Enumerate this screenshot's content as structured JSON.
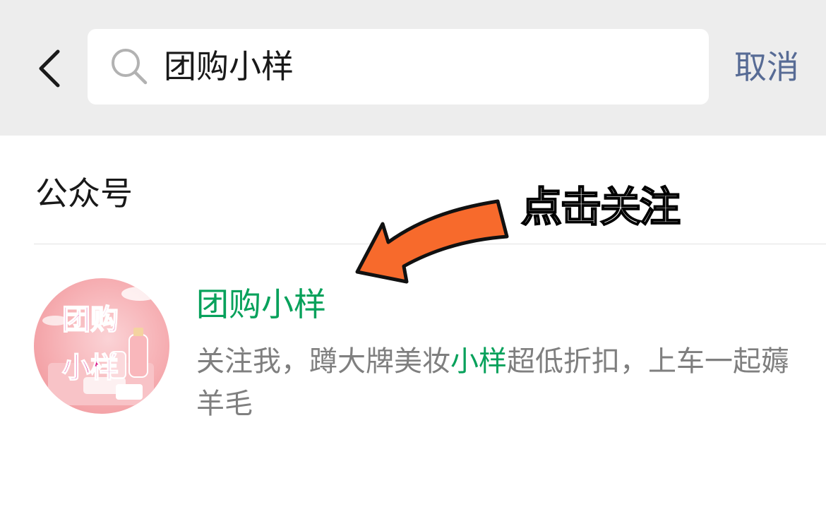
{
  "header": {
    "search": {
      "value": "团购小样"
    },
    "cancel_label": "取消"
  },
  "section": {
    "title": "公众号"
  },
  "annotation": {
    "text": "点击关注",
    "arrow_color": "#f76a2c"
  },
  "result": {
    "title": "团购小样",
    "avatar_lines": [
      "团购",
      "小样"
    ],
    "desc_before": "关注我，蹲大牌美妆",
    "desc_highlight": "小样",
    "desc_after": "超低折扣，上车一起薅羊毛"
  },
  "colors": {
    "link_blue": "#576b95",
    "highlight_green": "#07a15b",
    "topbar_bg": "#ededed",
    "desc_gray": "#7f7f7f"
  },
  "icons": [
    "chevron-left-icon",
    "search-icon",
    "arrow-annotation"
  ]
}
